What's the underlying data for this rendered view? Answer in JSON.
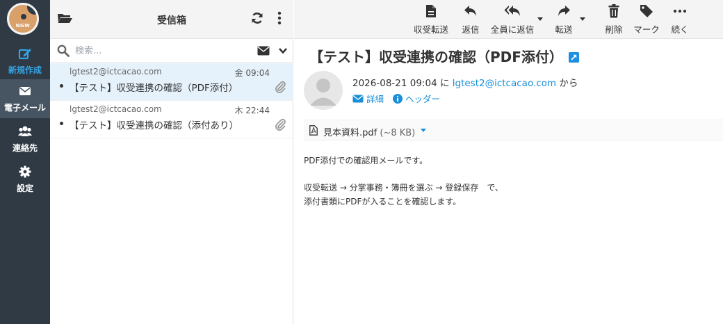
{
  "nav": {
    "logo_text": "NGW",
    "items": [
      {
        "label": "新規作成",
        "icon": "compose-icon"
      },
      {
        "label": "電子メール",
        "icon": "mail-icon"
      },
      {
        "label": "連絡先",
        "icon": "contacts-icon"
      },
      {
        "label": "設定",
        "icon": "gear-icon"
      }
    ]
  },
  "list": {
    "title": "受信箱",
    "search_placeholder": "検索...",
    "messages": [
      {
        "from": "lgtest2@ictcacao.com",
        "date": "金 09:04",
        "subject": "【テスト】収受連携の確認（PDF添付）",
        "has_attachment": true,
        "selected": true
      },
      {
        "from": "lgtest2@ictcacao.com",
        "date": "木 22:44",
        "subject": "【テスト】収受連携の確認（添付あり）",
        "has_attachment": true,
        "selected": false
      }
    ]
  },
  "toolbar": {
    "items": [
      {
        "label": "収受転送",
        "icon": "document-icon"
      },
      {
        "label": "返信",
        "icon": "reply-icon"
      },
      {
        "label": "全員に返信",
        "icon": "reply-all-icon"
      },
      {
        "label": "転送",
        "icon": "forward-icon"
      },
      {
        "label": "削除",
        "icon": "trash-icon"
      },
      {
        "label": "マーク",
        "icon": "tag-icon"
      },
      {
        "label": "続く",
        "icon": "more-horizontal-icon"
      }
    ]
  },
  "message": {
    "subject": "【テスト】収受連携の確認（PDF添付）",
    "date": "2026-08-21 09:04",
    "date_suffix": "に",
    "from": "lgtest2@ictcacao.com",
    "from_suffix": "から",
    "details_label": "詳細",
    "headers_label": "ヘッダー",
    "attachment": {
      "name": "見本資料.pdf",
      "size": "(~8 KB)"
    },
    "body_lines": [
      "PDF添付での確認用メールです。",
      "",
      "収受転送 → 分掌事務・簿冊を選ぶ → 登録保存　で、",
      "添付書類にPDFが入ることを確認します。"
    ]
  },
  "colors": {
    "nav_bg": "#2f3a44",
    "accent": "#1a8fd8",
    "selected_row": "#e6f2fb"
  }
}
